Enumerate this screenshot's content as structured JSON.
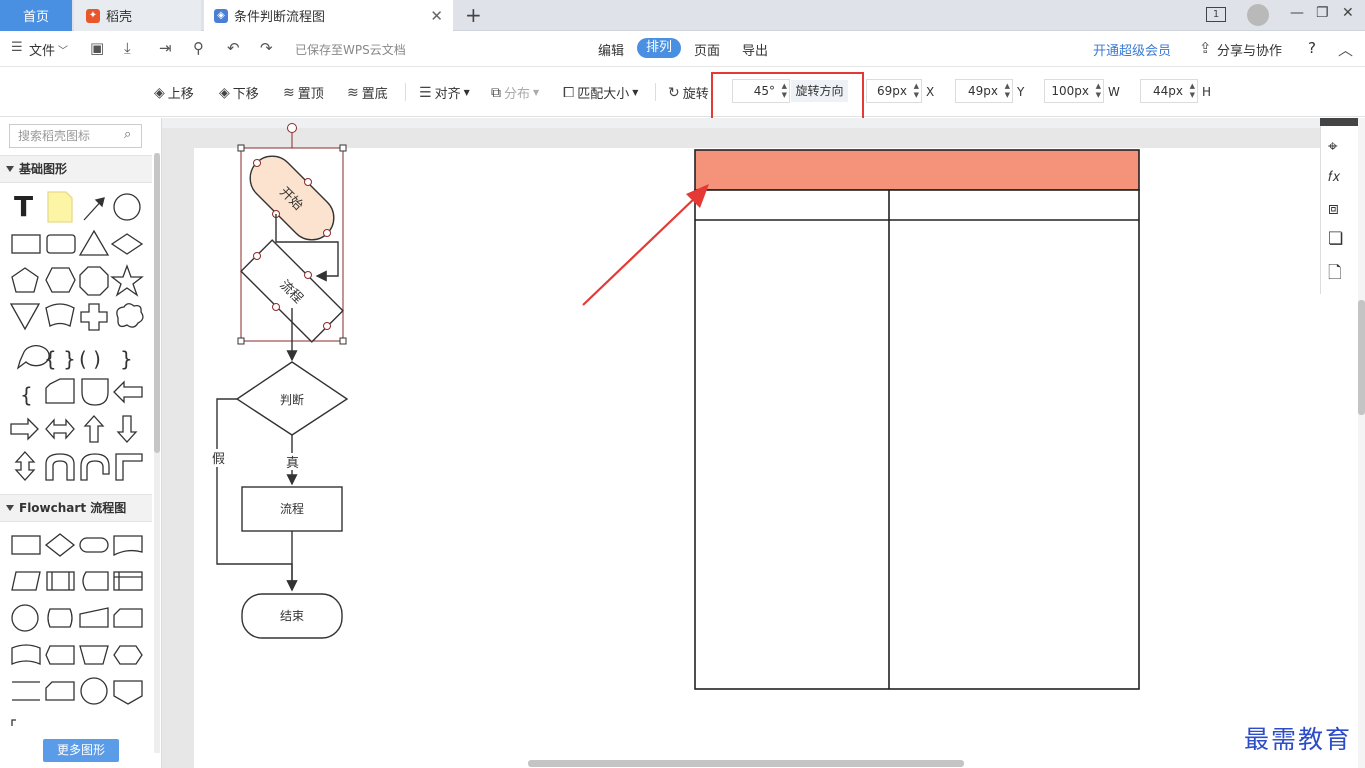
{
  "tabs": {
    "home": "首页",
    "daoke": "稻壳",
    "doc": "条件判断流程图",
    "page_count": "1"
  },
  "menubar": {
    "file": "文件",
    "saved_status": "已保存至WPS云文档",
    "edit": "编辑",
    "arrange": "排列",
    "page": "页面",
    "export": "导出",
    "vip": "开通超级会员",
    "share": "分享与协作",
    "help": "?"
  },
  "toolbar": {
    "move_up": "上移",
    "move_down": "下移",
    "to_top": "置顶",
    "to_bottom": "置底",
    "align": "对齐",
    "distribute": "分布",
    "match_size": "匹配大小",
    "rotate": "旋转",
    "rotate_value": "45°",
    "rotate_direction": "旋转方向",
    "x_value": "69px",
    "x_label": "X",
    "y_value": "49px",
    "y_label": "Y",
    "w_value": "100px",
    "w_label": "W",
    "h_value": "44px",
    "h_label": "H"
  },
  "left_panel": {
    "search_placeholder": "搜索稻壳图标",
    "basic_shapes": "基础图形",
    "flowchart": "Flowchart 流程图",
    "more_shapes": "更多图形"
  },
  "diagram": {
    "start": "开始",
    "process1": "流程",
    "decision": "判断",
    "false_label": "假",
    "true_label": "真",
    "process2": "流程",
    "end": "结束"
  },
  "table_colors": {
    "header": "#f4937a",
    "border": "#222222"
  },
  "watermark": "最需教育"
}
